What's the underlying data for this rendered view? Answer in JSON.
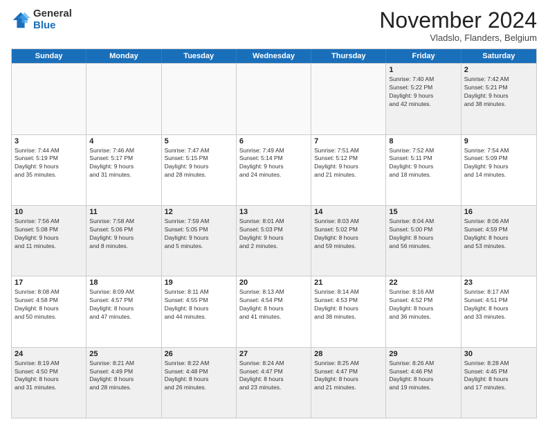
{
  "logo": {
    "general": "General",
    "blue": "Blue"
  },
  "title": "November 2024",
  "subtitle": "Vladslo, Flanders, Belgium",
  "header_days": [
    "Sunday",
    "Monday",
    "Tuesday",
    "Wednesday",
    "Thursday",
    "Friday",
    "Saturday"
  ],
  "weeks": [
    [
      {
        "day": "",
        "info": ""
      },
      {
        "day": "",
        "info": ""
      },
      {
        "day": "",
        "info": ""
      },
      {
        "day": "",
        "info": ""
      },
      {
        "day": "",
        "info": ""
      },
      {
        "day": "1",
        "info": "Sunrise: 7:40 AM\nSunset: 5:22 PM\nDaylight: 9 hours\nand 42 minutes."
      },
      {
        "day": "2",
        "info": "Sunrise: 7:42 AM\nSunset: 5:21 PM\nDaylight: 9 hours\nand 38 minutes."
      }
    ],
    [
      {
        "day": "3",
        "info": "Sunrise: 7:44 AM\nSunset: 5:19 PM\nDaylight: 9 hours\nand 35 minutes."
      },
      {
        "day": "4",
        "info": "Sunrise: 7:46 AM\nSunset: 5:17 PM\nDaylight: 9 hours\nand 31 minutes."
      },
      {
        "day": "5",
        "info": "Sunrise: 7:47 AM\nSunset: 5:15 PM\nDaylight: 9 hours\nand 28 minutes."
      },
      {
        "day": "6",
        "info": "Sunrise: 7:49 AM\nSunset: 5:14 PM\nDaylight: 9 hours\nand 24 minutes."
      },
      {
        "day": "7",
        "info": "Sunrise: 7:51 AM\nSunset: 5:12 PM\nDaylight: 9 hours\nand 21 minutes."
      },
      {
        "day": "8",
        "info": "Sunrise: 7:52 AM\nSunset: 5:11 PM\nDaylight: 9 hours\nand 18 minutes."
      },
      {
        "day": "9",
        "info": "Sunrise: 7:54 AM\nSunset: 5:09 PM\nDaylight: 9 hours\nand 14 minutes."
      }
    ],
    [
      {
        "day": "10",
        "info": "Sunrise: 7:56 AM\nSunset: 5:08 PM\nDaylight: 9 hours\nand 11 minutes."
      },
      {
        "day": "11",
        "info": "Sunrise: 7:58 AM\nSunset: 5:06 PM\nDaylight: 9 hours\nand 8 minutes."
      },
      {
        "day": "12",
        "info": "Sunrise: 7:59 AM\nSunset: 5:05 PM\nDaylight: 9 hours\nand 5 minutes."
      },
      {
        "day": "13",
        "info": "Sunrise: 8:01 AM\nSunset: 5:03 PM\nDaylight: 9 hours\nand 2 minutes."
      },
      {
        "day": "14",
        "info": "Sunrise: 8:03 AM\nSunset: 5:02 PM\nDaylight: 8 hours\nand 59 minutes."
      },
      {
        "day": "15",
        "info": "Sunrise: 8:04 AM\nSunset: 5:00 PM\nDaylight: 8 hours\nand 56 minutes."
      },
      {
        "day": "16",
        "info": "Sunrise: 8:06 AM\nSunset: 4:59 PM\nDaylight: 8 hours\nand 53 minutes."
      }
    ],
    [
      {
        "day": "17",
        "info": "Sunrise: 8:08 AM\nSunset: 4:58 PM\nDaylight: 8 hours\nand 50 minutes."
      },
      {
        "day": "18",
        "info": "Sunrise: 8:09 AM\nSunset: 4:57 PM\nDaylight: 8 hours\nand 47 minutes."
      },
      {
        "day": "19",
        "info": "Sunrise: 8:11 AM\nSunset: 4:55 PM\nDaylight: 8 hours\nand 44 minutes."
      },
      {
        "day": "20",
        "info": "Sunrise: 8:13 AM\nSunset: 4:54 PM\nDaylight: 8 hours\nand 41 minutes."
      },
      {
        "day": "21",
        "info": "Sunrise: 8:14 AM\nSunset: 4:53 PM\nDaylight: 8 hours\nand 38 minutes."
      },
      {
        "day": "22",
        "info": "Sunrise: 8:16 AM\nSunset: 4:52 PM\nDaylight: 8 hours\nand 36 minutes."
      },
      {
        "day": "23",
        "info": "Sunrise: 8:17 AM\nSunset: 4:51 PM\nDaylight: 8 hours\nand 33 minutes."
      }
    ],
    [
      {
        "day": "24",
        "info": "Sunrise: 8:19 AM\nSunset: 4:50 PM\nDaylight: 8 hours\nand 31 minutes."
      },
      {
        "day": "25",
        "info": "Sunrise: 8:21 AM\nSunset: 4:49 PM\nDaylight: 8 hours\nand 28 minutes."
      },
      {
        "day": "26",
        "info": "Sunrise: 8:22 AM\nSunset: 4:48 PM\nDaylight: 8 hours\nand 26 minutes."
      },
      {
        "day": "27",
        "info": "Sunrise: 8:24 AM\nSunset: 4:47 PM\nDaylight: 8 hours\nand 23 minutes."
      },
      {
        "day": "28",
        "info": "Sunrise: 8:25 AM\nSunset: 4:47 PM\nDaylight: 8 hours\nand 21 minutes."
      },
      {
        "day": "29",
        "info": "Sunrise: 8:26 AM\nSunset: 4:46 PM\nDaylight: 8 hours\nand 19 minutes."
      },
      {
        "day": "30",
        "info": "Sunrise: 8:28 AM\nSunset: 4:45 PM\nDaylight: 8 hours\nand 17 minutes."
      }
    ]
  ]
}
